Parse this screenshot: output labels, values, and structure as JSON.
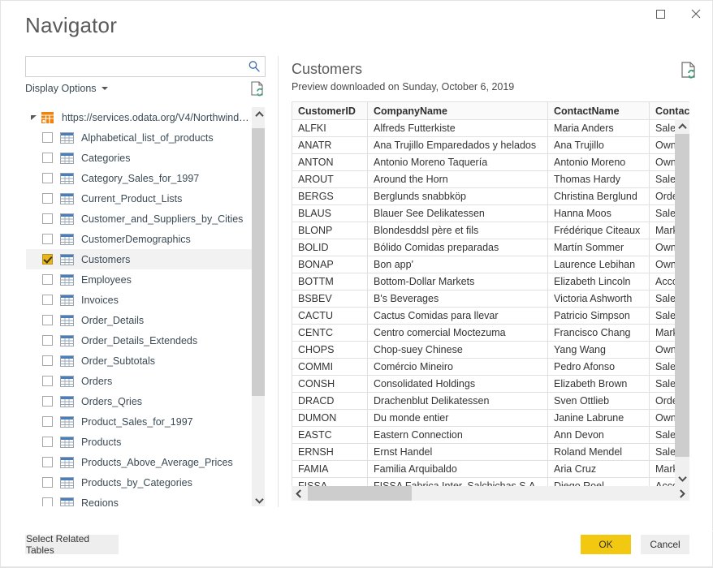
{
  "window": {
    "title": "Navigator",
    "controls": [
      {
        "name": "maximize-button",
        "icon": "square-icon",
        "label": ""
      },
      {
        "name": "close-button",
        "icon": "close-icon",
        "label": ""
      }
    ]
  },
  "left_pane": {
    "search": {
      "value": "",
      "placeholder": "",
      "icon": "search-icon"
    },
    "display_options": {
      "label": "Display Options",
      "caret_icon": "chevron-down-icon"
    },
    "refresh_icon": "refresh-document-icon",
    "tree": {
      "root": {
        "label": "https://services.odata.org/V4/Northwind/N...",
        "icon": "odata-feed-icon",
        "expander_icon": "expander-collapse-icon",
        "expanded": true
      },
      "items": [
        {
          "label": "Alphabetical_list_of_products",
          "checked": false,
          "selected": false
        },
        {
          "label": "Categories",
          "checked": false,
          "selected": false
        },
        {
          "label": "Category_Sales_for_1997",
          "checked": false,
          "selected": false
        },
        {
          "label": "Current_Product_Lists",
          "checked": false,
          "selected": false
        },
        {
          "label": "Customer_and_Suppliers_by_Cities",
          "checked": false,
          "selected": false
        },
        {
          "label": "CustomerDemographics",
          "checked": false,
          "selected": false
        },
        {
          "label": "Customers",
          "checked": true,
          "selected": true
        },
        {
          "label": "Employees",
          "checked": false,
          "selected": false
        },
        {
          "label": "Invoices",
          "checked": false,
          "selected": false
        },
        {
          "label": "Order_Details",
          "checked": false,
          "selected": false
        },
        {
          "label": "Order_Details_Extendeds",
          "checked": false,
          "selected": false
        },
        {
          "label": "Order_Subtotals",
          "checked": false,
          "selected": false
        },
        {
          "label": "Orders",
          "checked": false,
          "selected": false
        },
        {
          "label": "Orders_Qries",
          "checked": false,
          "selected": false
        },
        {
          "label": "Product_Sales_for_1997",
          "checked": false,
          "selected": false
        },
        {
          "label": "Products",
          "checked": false,
          "selected": false
        },
        {
          "label": "Products_Above_Average_Prices",
          "checked": false,
          "selected": false
        },
        {
          "label": "Products_by_Categories",
          "checked": false,
          "selected": false
        },
        {
          "label": "Regions",
          "checked": false,
          "selected": false
        }
      ]
    },
    "scrollbar": {
      "up_icon": "chevron-up-icon",
      "down_icon": "chevron-down-icon"
    }
  },
  "right_pane": {
    "title": "Customers",
    "subtitle": "Preview downloaded on Sunday, October 6, 2019",
    "refresh_icon": "refresh-document-icon",
    "table": {
      "columns": [
        "CustomerID",
        "CompanyName",
        "ContactName",
        "ContactTitle"
      ],
      "rows": [
        [
          "ALFKI",
          "Alfreds Futterkiste",
          "Maria Anders",
          "Sales Representative"
        ],
        [
          "ANATR",
          "Ana Trujillo Emparedados y helados",
          "Ana Trujillo",
          "Owner"
        ],
        [
          "ANTON",
          "Antonio Moreno Taquería",
          "Antonio Moreno",
          "Owner"
        ],
        [
          "AROUT",
          "Around the Horn",
          "Thomas Hardy",
          "Sales Representative"
        ],
        [
          "BERGS",
          "Berglunds snabbköp",
          "Christina Berglund",
          "Order Administrator"
        ],
        [
          "BLAUS",
          "Blauer See Delikatessen",
          "Hanna Moos",
          "Sales Representative"
        ],
        [
          "BLONP",
          "Blondesddsl père et fils",
          "Frédérique Citeaux",
          "Marketing Manager"
        ],
        [
          "BOLID",
          "Bólido Comidas preparadas",
          "Martín Sommer",
          "Owner"
        ],
        [
          "BONAP",
          "Bon app'",
          "Laurence Lebihan",
          "Owner"
        ],
        [
          "BOTTM",
          "Bottom-Dollar Markets",
          "Elizabeth Lincoln",
          "Accounting Manager"
        ],
        [
          "BSBEV",
          "B's Beverages",
          "Victoria Ashworth",
          "Sales Representative"
        ],
        [
          "CACTU",
          "Cactus Comidas para llevar",
          "Patricio Simpson",
          "Sales Agent"
        ],
        [
          "CENTC",
          "Centro comercial Moctezuma",
          "Francisco Chang",
          "Marketing Manager"
        ],
        [
          "CHOPS",
          "Chop-suey Chinese",
          "Yang Wang",
          "Owner"
        ],
        [
          "COMMI",
          "Comércio Mineiro",
          "Pedro Afonso",
          "Sales Associate"
        ],
        [
          "CONSH",
          "Consolidated Holdings",
          "Elizabeth Brown",
          "Sales Representative"
        ],
        [
          "DRACD",
          "Drachenblut Delikatessen",
          "Sven Ottlieb",
          "Order Administrator"
        ],
        [
          "DUMON",
          "Du monde entier",
          "Janine Labrune",
          "Owner"
        ],
        [
          "EASTC",
          "Eastern Connection",
          "Ann Devon",
          "Sales Agent"
        ],
        [
          "ERNSH",
          "Ernst Handel",
          "Roland Mendel",
          "Sales Manager"
        ],
        [
          "FAMIA",
          "Familia Arquibaldo",
          "Aria Cruz",
          "Marketing Assistant"
        ],
        [
          "FISSA",
          "FISSA Fabrica Inter. Salchichas S.A.",
          "Diego Roel",
          "Accounting Manager"
        ]
      ]
    },
    "scrollbar_v": {
      "up_icon": "chevron-up-icon",
      "down_icon": "chevron-down-icon"
    },
    "scrollbar_h": {
      "left_icon": "chevron-left-icon",
      "right_icon": "chevron-right-icon"
    }
  },
  "footer": {
    "select_related_label": "Select Related Tables",
    "ok_label": "OK",
    "cancel_label": "Cancel"
  },
  "colors": {
    "accent": "#f2c811",
    "checkbox_checked": "#e8b61c",
    "odata_icon": "#f2820a",
    "table_icon": "#4a7ebb",
    "text": "#333333",
    "title_text": "#5a5a5a"
  }
}
